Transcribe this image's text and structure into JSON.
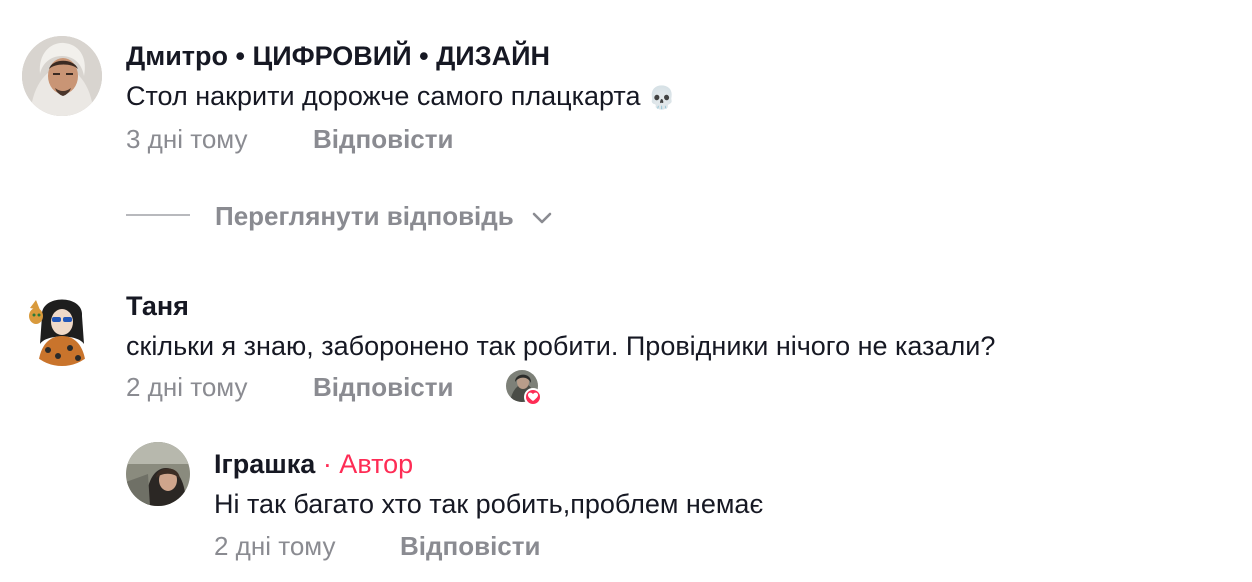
{
  "comments": [
    {
      "author": "Дмитро • ЦИФРОВИЙ • ДИЗАЙН",
      "text": "Стол накрити дорожче самого плацкарта",
      "emoji": "💀",
      "time": "3 дні тому",
      "reply_label": "Відповісти",
      "view_replies_label": "Переглянути відповідь"
    },
    {
      "author": "Таня",
      "text": "скільки я знаю, заборонено так робити. Провідники нічого не казали?",
      "time": "2 дні тому",
      "reply_label": "Відповісти",
      "liked_by_creator": true,
      "replies": [
        {
          "author": "Іграшка",
          "badge": "· Автор",
          "text": "Ні так багато хто так робить,проблем немає",
          "time": "2 дні тому",
          "reply_label": "Відповісти"
        }
      ]
    }
  ],
  "colors": {
    "text": "#161823",
    "muted": "#8a8b91",
    "author_badge": "#fe2c55",
    "like_heart": "#fe2c55"
  }
}
